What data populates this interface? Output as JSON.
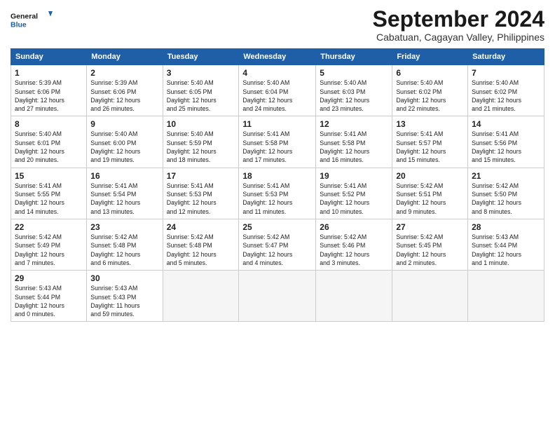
{
  "logo": {
    "line1": "General",
    "line2": "Blue"
  },
  "title": "September 2024",
  "subtitle": "Cabatuan, Cagayan Valley, Philippines",
  "days_of_week": [
    "Sunday",
    "Monday",
    "Tuesday",
    "Wednesday",
    "Thursday",
    "Friday",
    "Saturday"
  ],
  "weeks": [
    [
      {
        "day": "1",
        "info": "Sunrise: 5:39 AM\nSunset: 6:06 PM\nDaylight: 12 hours\nand 27 minutes."
      },
      {
        "day": "2",
        "info": "Sunrise: 5:39 AM\nSunset: 6:06 PM\nDaylight: 12 hours\nand 26 minutes."
      },
      {
        "day": "3",
        "info": "Sunrise: 5:40 AM\nSunset: 6:05 PM\nDaylight: 12 hours\nand 25 minutes."
      },
      {
        "day": "4",
        "info": "Sunrise: 5:40 AM\nSunset: 6:04 PM\nDaylight: 12 hours\nand 24 minutes."
      },
      {
        "day": "5",
        "info": "Sunrise: 5:40 AM\nSunset: 6:03 PM\nDaylight: 12 hours\nand 23 minutes."
      },
      {
        "day": "6",
        "info": "Sunrise: 5:40 AM\nSunset: 6:02 PM\nDaylight: 12 hours\nand 22 minutes."
      },
      {
        "day": "7",
        "info": "Sunrise: 5:40 AM\nSunset: 6:02 PM\nDaylight: 12 hours\nand 21 minutes."
      }
    ],
    [
      {
        "day": "8",
        "info": "Sunrise: 5:40 AM\nSunset: 6:01 PM\nDaylight: 12 hours\nand 20 minutes."
      },
      {
        "day": "9",
        "info": "Sunrise: 5:40 AM\nSunset: 6:00 PM\nDaylight: 12 hours\nand 19 minutes."
      },
      {
        "day": "10",
        "info": "Sunrise: 5:40 AM\nSunset: 5:59 PM\nDaylight: 12 hours\nand 18 minutes."
      },
      {
        "day": "11",
        "info": "Sunrise: 5:41 AM\nSunset: 5:58 PM\nDaylight: 12 hours\nand 17 minutes."
      },
      {
        "day": "12",
        "info": "Sunrise: 5:41 AM\nSunset: 5:58 PM\nDaylight: 12 hours\nand 16 minutes."
      },
      {
        "day": "13",
        "info": "Sunrise: 5:41 AM\nSunset: 5:57 PM\nDaylight: 12 hours\nand 15 minutes."
      },
      {
        "day": "14",
        "info": "Sunrise: 5:41 AM\nSunset: 5:56 PM\nDaylight: 12 hours\nand 15 minutes."
      }
    ],
    [
      {
        "day": "15",
        "info": "Sunrise: 5:41 AM\nSunset: 5:55 PM\nDaylight: 12 hours\nand 14 minutes."
      },
      {
        "day": "16",
        "info": "Sunrise: 5:41 AM\nSunset: 5:54 PM\nDaylight: 12 hours\nand 13 minutes."
      },
      {
        "day": "17",
        "info": "Sunrise: 5:41 AM\nSunset: 5:53 PM\nDaylight: 12 hours\nand 12 minutes."
      },
      {
        "day": "18",
        "info": "Sunrise: 5:41 AM\nSunset: 5:53 PM\nDaylight: 12 hours\nand 11 minutes."
      },
      {
        "day": "19",
        "info": "Sunrise: 5:41 AM\nSunset: 5:52 PM\nDaylight: 12 hours\nand 10 minutes."
      },
      {
        "day": "20",
        "info": "Sunrise: 5:42 AM\nSunset: 5:51 PM\nDaylight: 12 hours\nand 9 minutes."
      },
      {
        "day": "21",
        "info": "Sunrise: 5:42 AM\nSunset: 5:50 PM\nDaylight: 12 hours\nand 8 minutes."
      }
    ],
    [
      {
        "day": "22",
        "info": "Sunrise: 5:42 AM\nSunset: 5:49 PM\nDaylight: 12 hours\nand 7 minutes."
      },
      {
        "day": "23",
        "info": "Sunrise: 5:42 AM\nSunset: 5:48 PM\nDaylight: 12 hours\nand 6 minutes."
      },
      {
        "day": "24",
        "info": "Sunrise: 5:42 AM\nSunset: 5:48 PM\nDaylight: 12 hours\nand 5 minutes."
      },
      {
        "day": "25",
        "info": "Sunrise: 5:42 AM\nSunset: 5:47 PM\nDaylight: 12 hours\nand 4 minutes."
      },
      {
        "day": "26",
        "info": "Sunrise: 5:42 AM\nSunset: 5:46 PM\nDaylight: 12 hours\nand 3 minutes."
      },
      {
        "day": "27",
        "info": "Sunrise: 5:42 AM\nSunset: 5:45 PM\nDaylight: 12 hours\nand 2 minutes."
      },
      {
        "day": "28",
        "info": "Sunrise: 5:43 AM\nSunset: 5:44 PM\nDaylight: 12 hours\nand 1 minute."
      }
    ],
    [
      {
        "day": "29",
        "info": "Sunrise: 5:43 AM\nSunset: 5:44 PM\nDaylight: 12 hours\nand 0 minutes."
      },
      {
        "day": "30",
        "info": "Sunrise: 5:43 AM\nSunset: 5:43 PM\nDaylight: 11 hours\nand 59 minutes."
      },
      {
        "day": "",
        "info": ""
      },
      {
        "day": "",
        "info": ""
      },
      {
        "day": "",
        "info": ""
      },
      {
        "day": "",
        "info": ""
      },
      {
        "day": "",
        "info": ""
      }
    ]
  ]
}
